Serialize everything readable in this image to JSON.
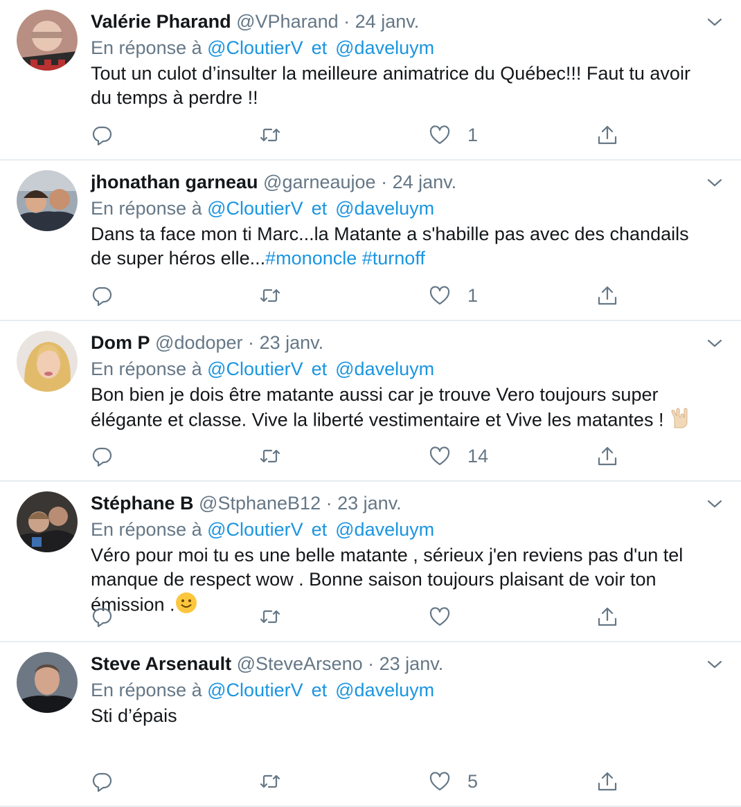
{
  "tweets": [
    {
      "name": "Valérie Pharand",
      "handle": "@VPharand",
      "date": "24 janv.",
      "reply_prefix": "En réponse à",
      "mention1": "@CloutierV",
      "conj": "et",
      "mention2": "@daveluym",
      "text": "Tout un culot d’insulter la meilleure animatrice du Québec!!! Faut tu avoir du temps à perdre !!",
      "likes": "1",
      "avatar_color": "#c9a28f"
    },
    {
      "name": "jhonathan garneau",
      "handle": "@garneaujoe",
      "date": "24 janv.",
      "reply_prefix": "En réponse à",
      "mention1": "@CloutierV",
      "conj": "et",
      "mention2": "@daveluym",
      "text": "Dans ta face mon ti Marc...la Matante a s'habille pas avec des chandails de super héros elle...",
      "hashtag1": "#mononcle",
      "hashtag2": "#turnoff",
      "likes": "1",
      "avatar_color": "#8f8a84"
    },
    {
      "name": "Dom P",
      "handle": "@dodoper",
      "date": "23 janv.",
      "reply_prefix": "En réponse à",
      "mention1": "@CloutierV",
      "conj": "et",
      "mention2": "@daveluym",
      "text": "Bon bien je dois être matante aussi car je trouve Vero toujours super élégante et classe. Vive la liberté vestimentaire et Vive les matantes !",
      "emoji": "rock-on-hand",
      "likes": "14",
      "avatar_color": "#d8b07a"
    },
    {
      "name": "Stéphane B",
      "handle": "@StphaneB12",
      "date": "23 janv.",
      "reply_prefix": "En réponse à",
      "mention1": "@CloutierV",
      "conj": "et",
      "mention2": "@daveluym",
      "text": "Véro pour moi tu es une belle matante , sérieux j'en reviens pas d'un tel manque de respect wow . Bonne saison toujours plaisant de voir ton émission .",
      "emoji": "slightly-smiling-face",
      "likes": "",
      "avatar_color": "#4a4744"
    },
    {
      "name": "Steve Arsenault",
      "handle": "@SteveArseno",
      "date": "23 janv.",
      "reply_prefix": "En réponse à",
      "mention1": "@CloutierV",
      "conj": "et",
      "mention2": "@daveluym",
      "text": "Sti d’épais",
      "likes": "5",
      "avatar_color": "#5b6470"
    }
  ],
  "separator": "·",
  "icons": {
    "reply": "reply-icon",
    "retweet": "retweet-icon",
    "like": "heart-icon",
    "share": "share-icon",
    "more": "chevron-down-icon"
  },
  "colors": {
    "link": "#1b95e0",
    "muted": "#657786",
    "text": "#14171a",
    "border": "#e6ecf0"
  }
}
